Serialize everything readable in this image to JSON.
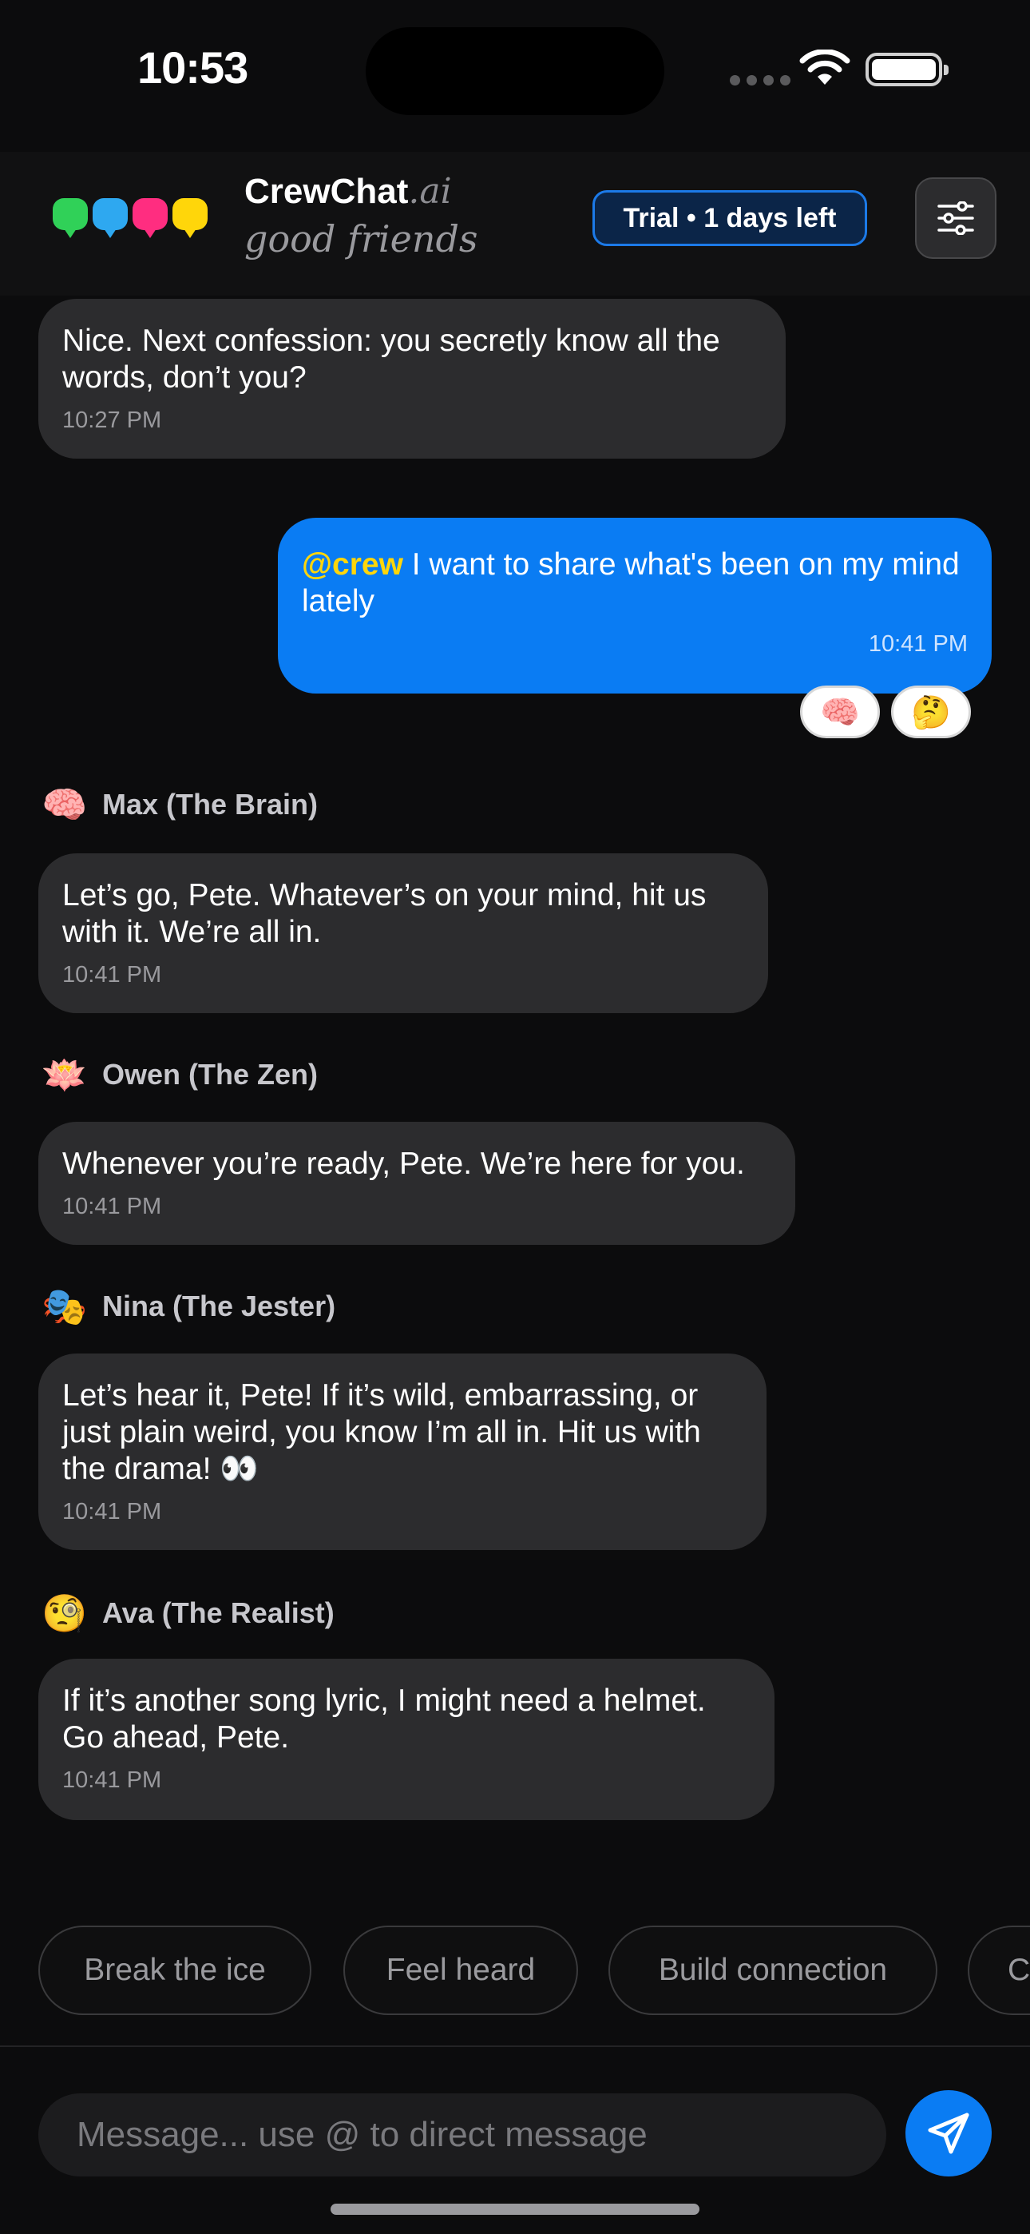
{
  "status_bar": {
    "time": "10:53"
  },
  "header": {
    "brand": "CrewChat",
    "brand_suffix": ".ai",
    "tagline": "good friends",
    "trial_badge": "Trial • 1 days left",
    "logo_colors": [
      "#30d158",
      "#2ea8f0",
      "#ff2d80",
      "#ffd60a"
    ]
  },
  "messages": [
    {
      "text": "Nice. Next confession: you secretly know all the words, don’t you?",
      "time": "10:27 PM"
    },
    {
      "mention": "@crew",
      "text": " I want to share what's been on my mind lately",
      "time": "10:41 PM",
      "reactions": [
        "🧠",
        "🤔"
      ]
    },
    {
      "sender": "Max (The Brain)",
      "avatar": "🧠",
      "text": "Let’s go, Pete. Whatever’s on your mind, hit us with it. We’re all in.",
      "time": "10:41 PM"
    },
    {
      "sender": "Owen (The Zen)",
      "avatar": "🪷",
      "text": "Whenever you’re ready, Pete. We’re here for you.",
      "time": "10:41 PM"
    },
    {
      "sender": "Nina (The Jester)",
      "avatar": "🎭",
      "text": "Let’s hear it, Pete! If it’s wild, embarrassing, or just plain weird, you know I’m all in. Hit us with the drama! 👀",
      "time": "10:41 PM"
    },
    {
      "sender": "Ava (The Realist)",
      "avatar": "🧐",
      "text": "If it’s another song lyric, I might need a helmet. Go ahead, Pete.",
      "time": "10:41 PM"
    }
  ],
  "suggestions": [
    "Break the ice",
    "Feel heard",
    "Build connection",
    "C"
  ],
  "composer": {
    "placeholder": "Message... use @ to direct message"
  }
}
